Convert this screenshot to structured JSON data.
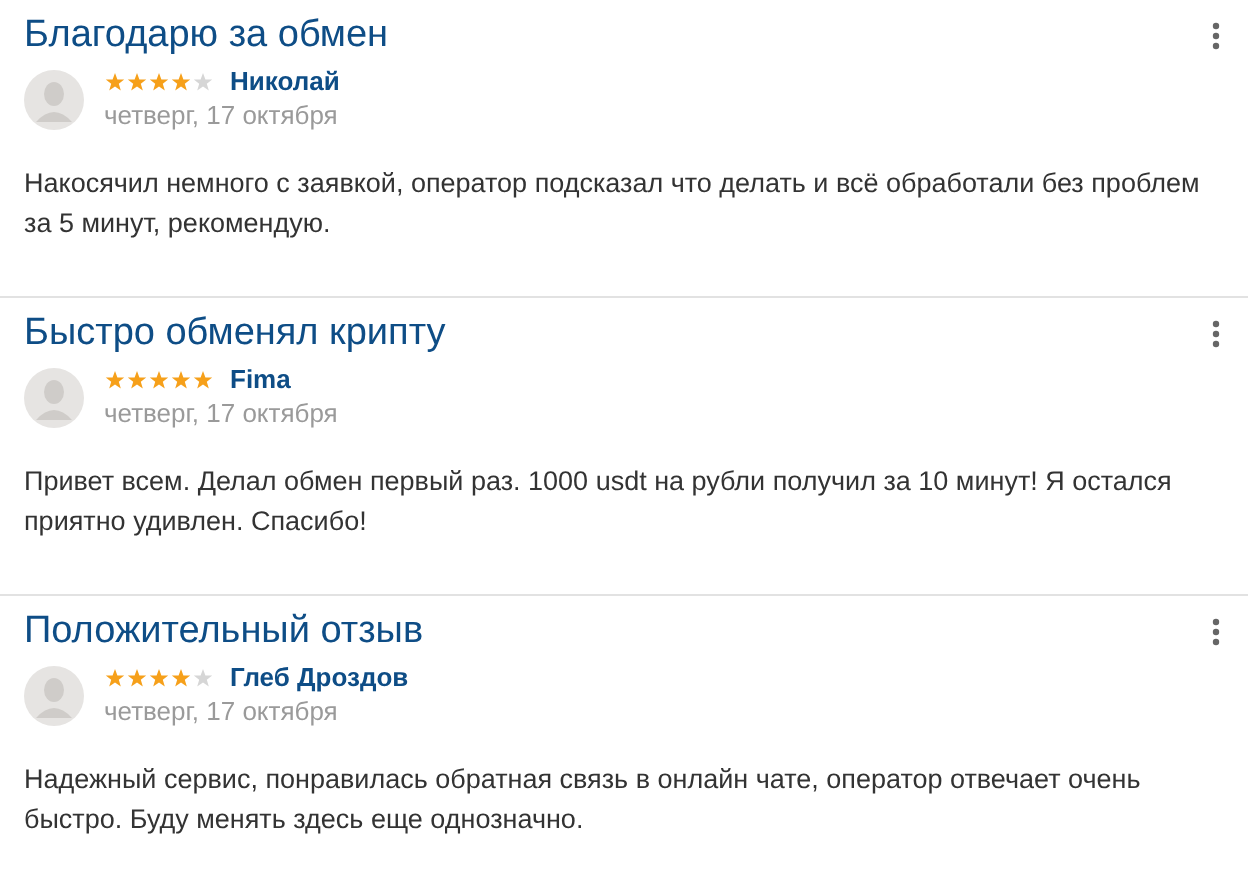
{
  "reviews": [
    {
      "title": "Благодарю за обмен",
      "stars": 4,
      "author": "Николай",
      "date": "четверг, 17 октября",
      "text": "Накосячил немного с заявкой, оператор подсказал что делать и всё обработали без проблем за 5 минут, рекомендую."
    },
    {
      "title": "Быстро обменял крипту",
      "stars": 5,
      "author": "Fima",
      "date": "четверг, 17 октября",
      "text": "Привет всем. Делал обмен первый раз. 1000 usdt на рубли получил за 10 минут! Я остался приятно удивлен. Спасибо!"
    },
    {
      "title": "Положительный отзыв",
      "stars": 4,
      "author": "Глеб Дроздов",
      "date": "четверг, 17 октября",
      "text": "Надежный сервис, понравилась обратная связь в онлайн чате, оператор отвечает очень быстро. Буду менять здесь еще однозначно."
    }
  ]
}
